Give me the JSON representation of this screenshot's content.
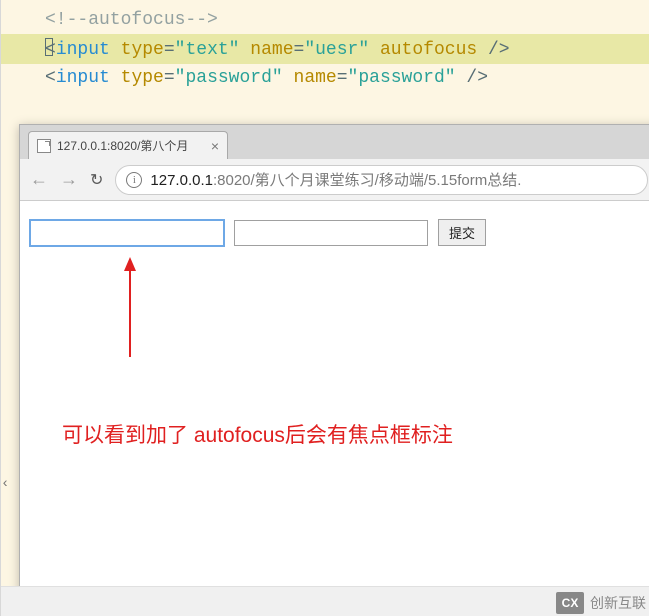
{
  "code": {
    "comment": "<!--autofocus-->",
    "line2": {
      "tag": "input",
      "attr_type": "type",
      "val_type": "\"text\"",
      "attr_name": "name",
      "val_name": "\"uesr\"",
      "attr_autofocus": "autofocus",
      "close": "/>"
    },
    "line3": {
      "tag": "input",
      "attr_type": "type",
      "val_type": "\"password\"",
      "attr_name": "name",
      "val_name": "\"password\"",
      "close": "/>"
    }
  },
  "browser": {
    "tab_title": "127.0.0.1:8020/第八个月",
    "tab_close": "×",
    "nav_back": "←",
    "nav_fwd": "→",
    "reload": "↻",
    "info_icon": "i",
    "url_host": "127.0.0.1",
    "url_rest": ":8020/第八个月课堂练习/移动端/5.15form总结.",
    "submit_label": "提交"
  },
  "annotation": "可以看到加了 autofocus后会有焦点框标注",
  "watermark": {
    "logo": "CX",
    "text": "创新互联"
  }
}
